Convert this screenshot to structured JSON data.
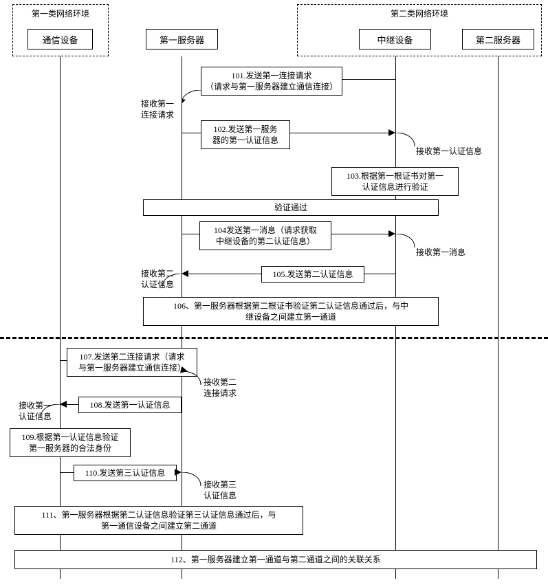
{
  "env1": {
    "title": "第一类网络环境"
  },
  "env2": {
    "title": "第二类网络环境"
  },
  "actors": {
    "comm": "通信设备",
    "srv1": "第一服务器",
    "relay": "中继设备",
    "srv2": "第二服务器"
  },
  "m101": {
    "line1": "101.发送第一连接请求",
    "line2": "（请求与第一服务器建立通信连接）"
  },
  "n101": {
    "line1": "接收第一",
    "line2": "连接请求"
  },
  "m102": {
    "line1": "102.发送第一服务",
    "line2": "器的第一认证信息"
  },
  "n102": "接收第一认证信息",
  "m103": {
    "line1": "103.根据第一根证书对第一",
    "line2": "认证信息进行验证"
  },
  "pass": "验证通过",
  "m104": {
    "line1": "104发送第一消息（请求获取",
    "line2": "中继设备的第二认证信息）"
  },
  "n104": "接收第一消息",
  "m105": "105.发送第二认证信息",
  "n105": {
    "line1": "接收第二",
    "line2": "认证信息"
  },
  "m106": {
    "line1": "106、第一服务器根据第二根证书验证第二认证信息通过后，与中",
    "line2": "继设备之间建立第一通道"
  },
  "m107": {
    "line1": "107.发送第二连接请求（请求",
    "line2": "与第一服务器建立通信连接）"
  },
  "n107": {
    "line1": "接收第二",
    "line2": "连接请求"
  },
  "m108": "108.发送第一认证信息",
  "n108": {
    "line1": "接收第一",
    "line2": "认证信息"
  },
  "m109": {
    "line1": "109.根据第一认证信息验证",
    "line2": "第一服务器的合法身份"
  },
  "m110": "110.发送第三认证信息",
  "n110": {
    "line1": "接收第三",
    "line2": "认证信息"
  },
  "m111": {
    "line1": "111、第一服务器根据第二认证信息验证第三认证信息通过后，与",
    "line2": "第一通信设备之间建立第二通道"
  },
  "m112": "112、第一服务器建立第一通道与第二通道之间的关联关系"
}
